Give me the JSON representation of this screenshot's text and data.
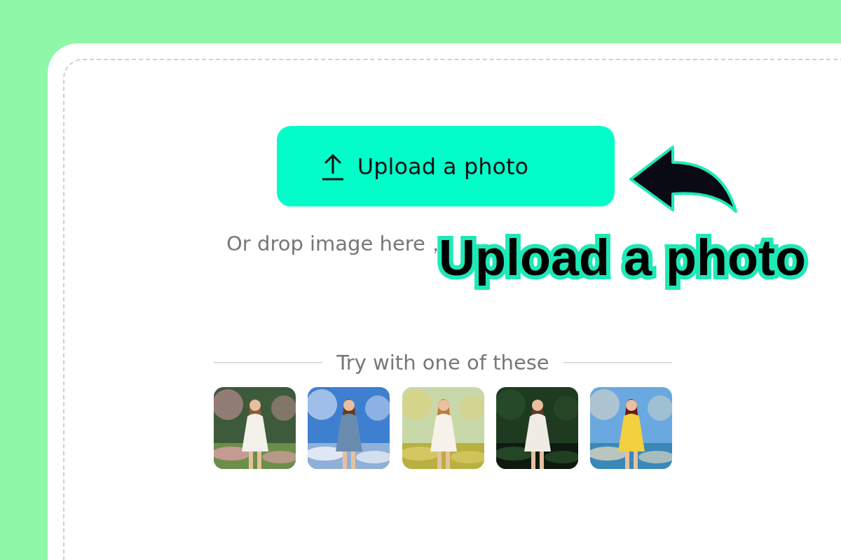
{
  "upload_button": {
    "label": "Upload a photo"
  },
  "hint": "Or drop image here，",
  "callout": {
    "label": "Upload a photo"
  },
  "samples_heading": "Try with one of these"
}
